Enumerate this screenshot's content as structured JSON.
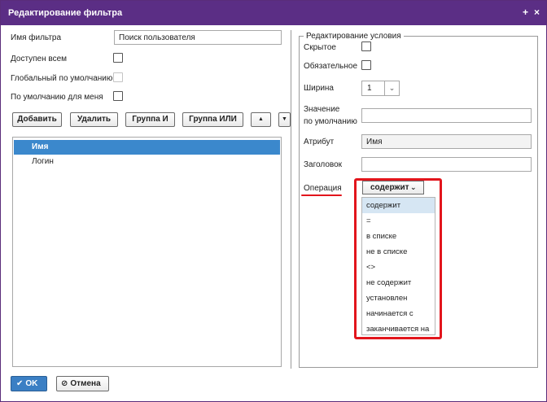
{
  "window": {
    "title": "Редактирование фильтра",
    "pin_glyph": "+",
    "close_glyph": "×"
  },
  "filter": {
    "name_label": "Имя фильтра",
    "name_value": "Поиск пользователя",
    "public_label": "Доступен всем",
    "global_default_label": "Глобальный по умолчанию",
    "my_default_label": "По умолчанию для меня"
  },
  "toolbar": {
    "add": "Добавить",
    "delete": "Удалить",
    "group_and": "Группа И",
    "group_or": "Группа ИЛИ",
    "up_glyph": "▲",
    "down_glyph": "▼"
  },
  "tree": {
    "items": [
      "Имя",
      "Логин"
    ]
  },
  "condition": {
    "legend": "Редактирование условия",
    "hidden_label": "Скрытое",
    "required_label": "Обязательное",
    "width_label": "Ширина",
    "width_value": "1",
    "default_label_line1": "Значение",
    "default_label_line2": "по умолчанию",
    "attribute_label": "Атрибут",
    "attribute_value": "Имя",
    "header_label": "Заголовок",
    "operation_label": "Операция",
    "operation_value": "содержит",
    "operation_options": [
      "содержит",
      "=",
      "в списке",
      "не в списке",
      "<>",
      "не содержит",
      "установлен",
      "начинается с",
      "заканчивается на"
    ]
  },
  "footer": {
    "ok": "OK",
    "cancel": "Отмена"
  },
  "colors": {
    "titlebar": "#5b2e85",
    "selection": "#3b88cc",
    "highlight_annotation": "#e2151c"
  }
}
